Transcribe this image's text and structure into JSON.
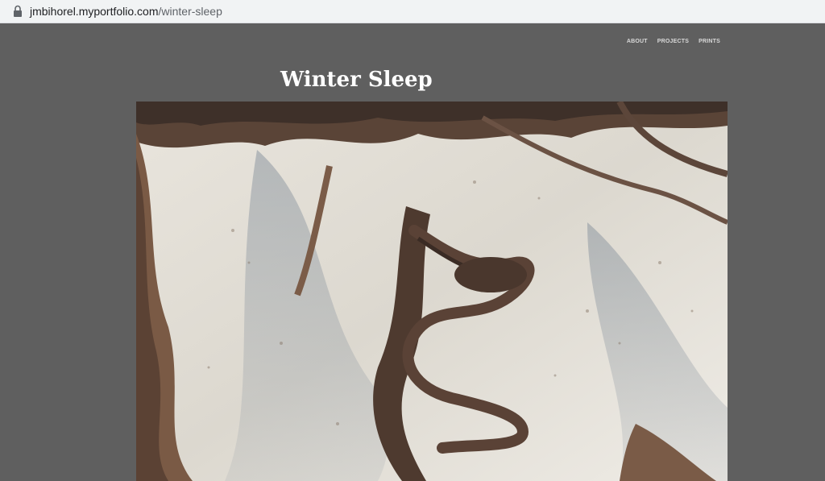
{
  "browser": {
    "url_domain": "jmbihorel.myportfolio.com",
    "url_path": "/winter-sleep"
  },
  "nav": {
    "items": [
      {
        "label": "ABOUT"
      },
      {
        "label": "PROJECTS"
      },
      {
        "label": "PRINTS"
      }
    ]
  },
  "page": {
    "title": "Winter Sleep"
  },
  "hero_image": {
    "subject": "aerial view of snow-covered mountain ridges with exposed brown rock"
  },
  "colors": {
    "page_background": "#5f5f5f",
    "title": "#ffffff",
    "nav_text": "#d9d9d9"
  }
}
